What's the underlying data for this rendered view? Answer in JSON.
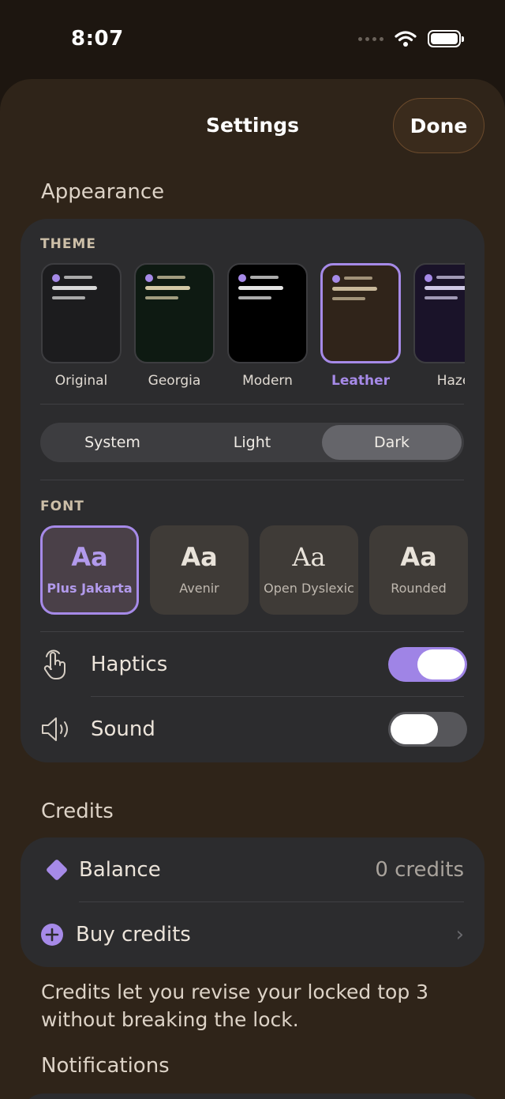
{
  "status_bar": {
    "time": "8:07"
  },
  "header": {
    "title": "Settings",
    "done_label": "Done"
  },
  "appearance": {
    "section_title": "Appearance",
    "theme_label": "THEME",
    "themes": [
      {
        "name": "Original",
        "bg": "#1c1c1e",
        "line": "#d9d9d9",
        "selected": false
      },
      {
        "name": "Georgia",
        "bg": "#0e1a12",
        "line": "#d4c9a6",
        "selected": false
      },
      {
        "name": "Modern",
        "bg": "#000000",
        "line": "#e5e5e5",
        "selected": false
      },
      {
        "name": "Leather",
        "bg": "#30241a",
        "line": "#c8b89a",
        "selected": true
      },
      {
        "name": "Haze",
        "bg": "#1a1329",
        "line": "#cfc8e6",
        "selected": false
      }
    ],
    "mode": {
      "options": [
        "System",
        "Light",
        "Dark"
      ],
      "selected": "Dark"
    },
    "font_label": "FONT",
    "fonts": [
      {
        "sample": "Aa",
        "name": "Plus Jakarta",
        "selected": true
      },
      {
        "sample": "Aa",
        "name": "Avenir",
        "selected": false
      },
      {
        "sample": "Aa",
        "name": "Open Dyslexic",
        "selected": false
      },
      {
        "sample": "Aa",
        "name": "Rounded",
        "selected": false
      }
    ],
    "haptics": {
      "label": "Haptics",
      "icon": "hand-tap-icon",
      "on": true
    },
    "sound": {
      "label": "Sound",
      "icon": "speaker-icon",
      "on": false
    }
  },
  "credits": {
    "section_title": "Credits",
    "balance_label": "Balance",
    "balance_value": "0 credits",
    "balance_icon": "diamond-icon",
    "buy_label": "Buy credits",
    "buy_icon": "plus-circle-icon",
    "footnote": "Credits let you revise your locked top 3 without breaking the lock."
  },
  "notifications": {
    "section_title": "Notifications"
  },
  "colors": {
    "accent": "#a68ae8",
    "sheet": "#2f2419",
    "card": "#2c2c2e"
  }
}
